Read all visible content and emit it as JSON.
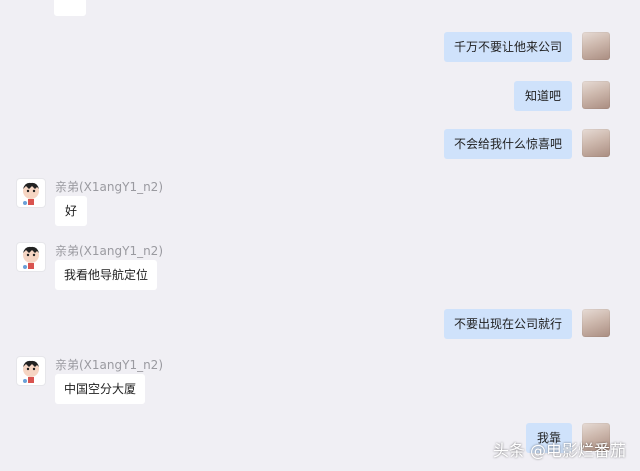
{
  "contact": {
    "display_name": "亲弟(X1angY1_n2)"
  },
  "messages": [
    {
      "side": "left",
      "text": "",
      "partial": true
    },
    {
      "side": "right",
      "text": "千万不要让他来公司"
    },
    {
      "side": "right",
      "text": "知道吧"
    },
    {
      "side": "right",
      "text": "不会给我什么惊喜吧"
    },
    {
      "side": "left",
      "sender": "亲弟(X1angY1_n2)",
      "text": "好"
    },
    {
      "side": "left",
      "sender": "亲弟(X1angY1_n2)",
      "text": "我看他导航定位"
    },
    {
      "side": "right",
      "text": "不要出现在公司就行"
    },
    {
      "side": "left",
      "sender": "亲弟(X1angY1_n2)",
      "text": "中国空分大厦"
    },
    {
      "side": "right",
      "text": "我靠"
    }
  ],
  "watermark": "头条 @电影烂番茄",
  "colors": {
    "background": "#f0eff4",
    "bubble_self": "#cfe2fb",
    "bubble_other": "#ffffff",
    "sender_name": "#9a9aa0"
  },
  "icons": {
    "self_avatar": "avatar-photo-icon",
    "other_avatar": "cartoon-avatar-icon"
  }
}
